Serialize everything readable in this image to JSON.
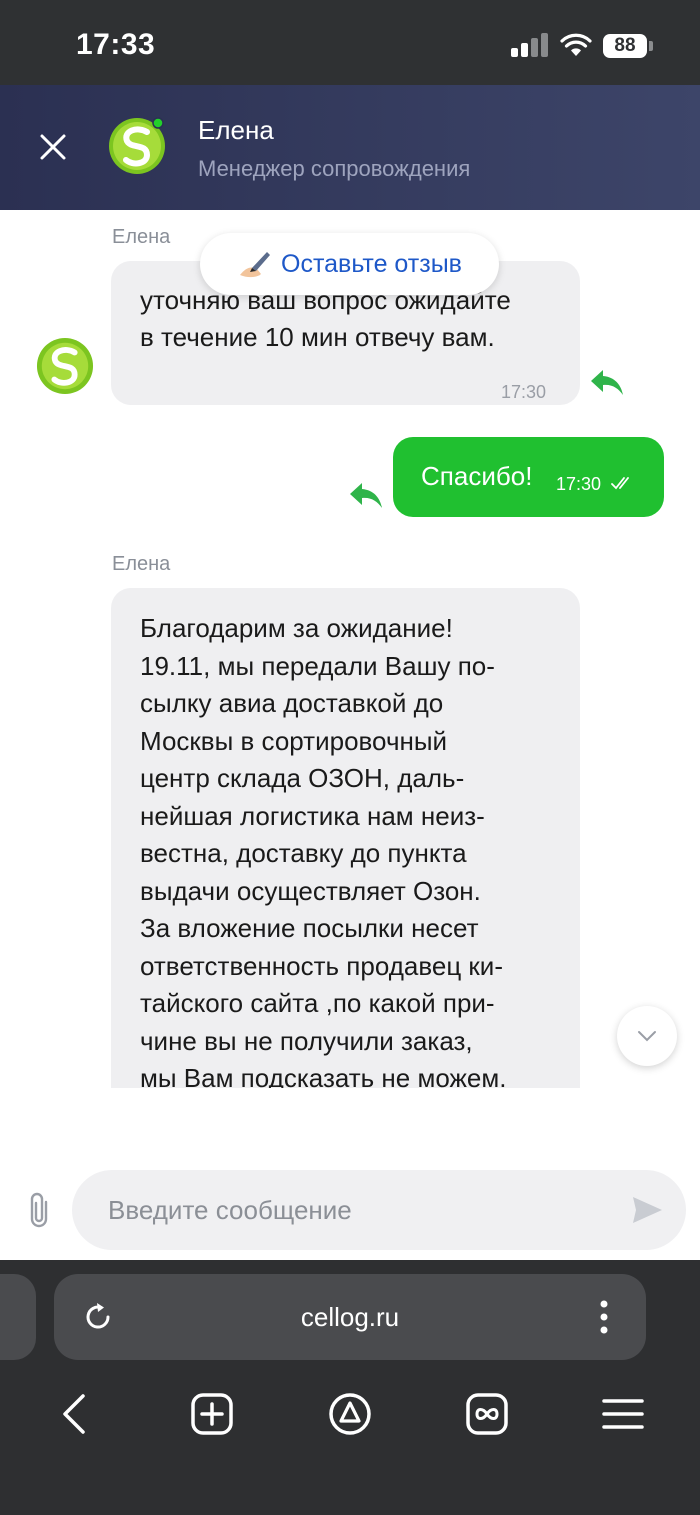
{
  "status_bar": {
    "time": "17:33",
    "battery": "88"
  },
  "header": {
    "name": "Елена",
    "subtitle": "Менеджер сопровождения"
  },
  "review_button": {
    "label": "Оставьте отзыв"
  },
  "messages": [
    {
      "sender": "Елена",
      "lines": [
        "уточняю ваш вопрос ожидайте",
        "в течение 10 мин отвечу вам."
      ],
      "time": "17:30"
    },
    {
      "text": "Спасибо!",
      "time": "17:30"
    },
    {
      "sender": "Елена",
      "lines": [
        "Благодарим за ожидание!",
        "19.11, мы передали Вашу по-",
        "сылку авиа доставкой до",
        "Москвы в сортировочный",
        "центр  склада ОЗОН, даль-",
        "нейшая логистика нам неиз-",
        "вестна, доставку до пункта",
        "выдачи осуществляет Озон.",
        "За вложение посылки несет",
        "ответственность продавец ки-",
        "тайского сайта ,по какой при-",
        "чине вы не получили заказ,",
        "мы Вам подсказать не можем."
      ]
    }
  ],
  "composer": {
    "placeholder": "Введите сообщение"
  },
  "browser": {
    "url": "cellog.ru"
  },
  "icons": {
    "close": "close-icon",
    "logo": "brand-logo",
    "reply": "reply-arrow-icon",
    "pen": "writing-hand-icon",
    "chevron": "chevron-down-icon",
    "clip": "paperclip-icon",
    "send": "send-icon",
    "reload": "reload-icon",
    "more": "more-vertical-icon",
    "back": "back-icon",
    "new_tab": "new-tab-icon",
    "alice": "alice-icon",
    "tabs": "tabs-icon",
    "menu": "menu-icon"
  },
  "colors": {
    "accent_green": "#20c030",
    "header_bg": "#2b3052",
    "link_blue": "#1e58c8"
  }
}
